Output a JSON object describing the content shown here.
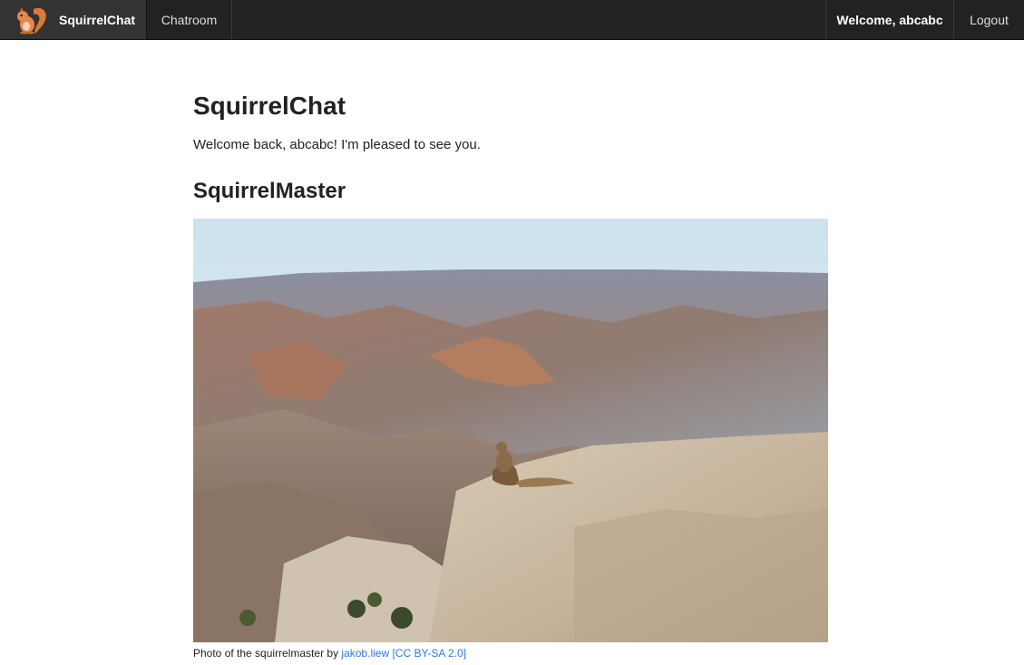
{
  "navbar": {
    "brand_label": "SquirrelChat",
    "brand_logo_icon": "squirrel-icon",
    "chatroom_label": "Chatroom",
    "welcome_label": "Welcome, abcabc",
    "logout_label": "Logout"
  },
  "main": {
    "title": "SquirrelChat",
    "welcome_text": "Welcome back, abcabc! I'm pleased to see you.",
    "subtitle": "SquirrelMaster",
    "photo_description_icon": "squirrel-canyon-photo",
    "caption": {
      "prefix": "Photo of the squirrelmaster by ",
      "author_link": "jakob.liew",
      "license_link": "[CC BY-SA 2.0]"
    }
  },
  "colors": {
    "navbar_bg": "#222222",
    "brand_bg": "#333333",
    "link": "#2a7ae2"
  }
}
